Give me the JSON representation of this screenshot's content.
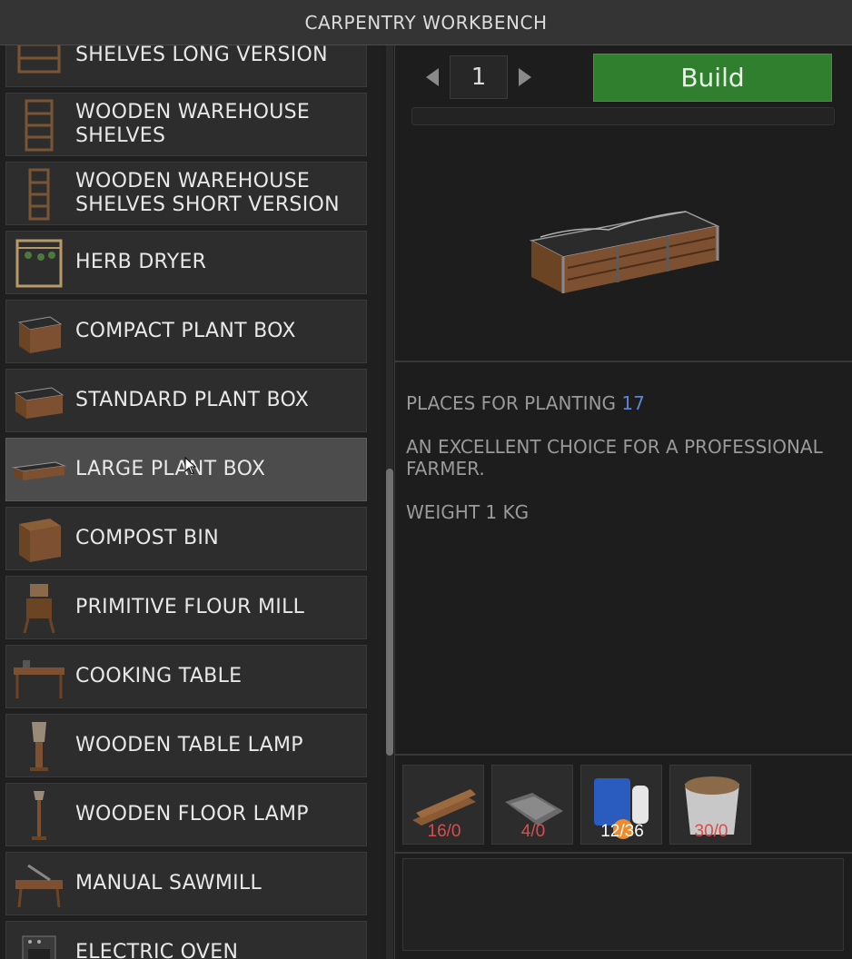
{
  "window": {
    "title": "CARPENTRY WORKBENCH"
  },
  "recipes": [
    {
      "label": "SHELVES LONG VERSION",
      "icon": "shelves-long-icon",
      "selected": false
    },
    {
      "label": "WOODEN WAREHOUSE\nSHELVES",
      "icon": "warehouse-shelves-icon",
      "selected": false
    },
    {
      "label": "WOODEN WAREHOUSE\nSHELVES SHORT VERSION",
      "icon": "warehouse-shelves-short-icon",
      "selected": false
    },
    {
      "label": "HERB DRYER",
      "icon": "herb-dryer-icon",
      "selected": false
    },
    {
      "label": "COMPACT PLANT BOX",
      "icon": "compact-plant-box-icon",
      "selected": false
    },
    {
      "label": "STANDARD PLANT BOX",
      "icon": "standard-plant-box-icon",
      "selected": false
    },
    {
      "label": "LARGE PLANT BOX",
      "icon": "large-plant-box-icon",
      "selected": true
    },
    {
      "label": "COMPOST BIN",
      "icon": "compost-bin-icon",
      "selected": false
    },
    {
      "label": "PRIMITIVE FLOUR MILL",
      "icon": "flour-mill-icon",
      "selected": false
    },
    {
      "label": "COOKING TABLE",
      "icon": "cooking-table-icon",
      "selected": false
    },
    {
      "label": "WOODEN TABLE LAMP",
      "icon": "table-lamp-icon",
      "selected": false
    },
    {
      "label": "WOODEN FLOOR LAMP",
      "icon": "floor-lamp-icon",
      "selected": false
    },
    {
      "label": "MANUAL SAWMILL",
      "icon": "sawmill-icon",
      "selected": false
    },
    {
      "label": "ELECTRIC OVEN",
      "icon": "electric-oven-icon",
      "selected": false
    }
  ],
  "craft": {
    "quantity": "1",
    "build_label": "Build",
    "progress": 0
  },
  "details": {
    "planting_label": "PLACES FOR PLANTING",
    "planting_value": "17",
    "description": "AN EXCELLENT CHOICE FOR A PROFESSIONAL FARMER.",
    "weight": "WEIGHT 1 KG"
  },
  "ingredients": [
    {
      "icon": "planks-icon",
      "count": "16/0",
      "sufficient": false
    },
    {
      "icon": "nails-icon",
      "count": "4/0",
      "sufficient": false
    },
    {
      "icon": "water-canister-icon",
      "count": "12/36",
      "sufficient": true
    },
    {
      "icon": "soil-bucket-icon",
      "count": "30/0",
      "sufficient": false
    }
  ],
  "colors": {
    "build_button": "#2f7f2f",
    "highlight_value": "#5a86d6",
    "missing_count": "#d84e4e",
    "available_count": "#ffffff"
  }
}
